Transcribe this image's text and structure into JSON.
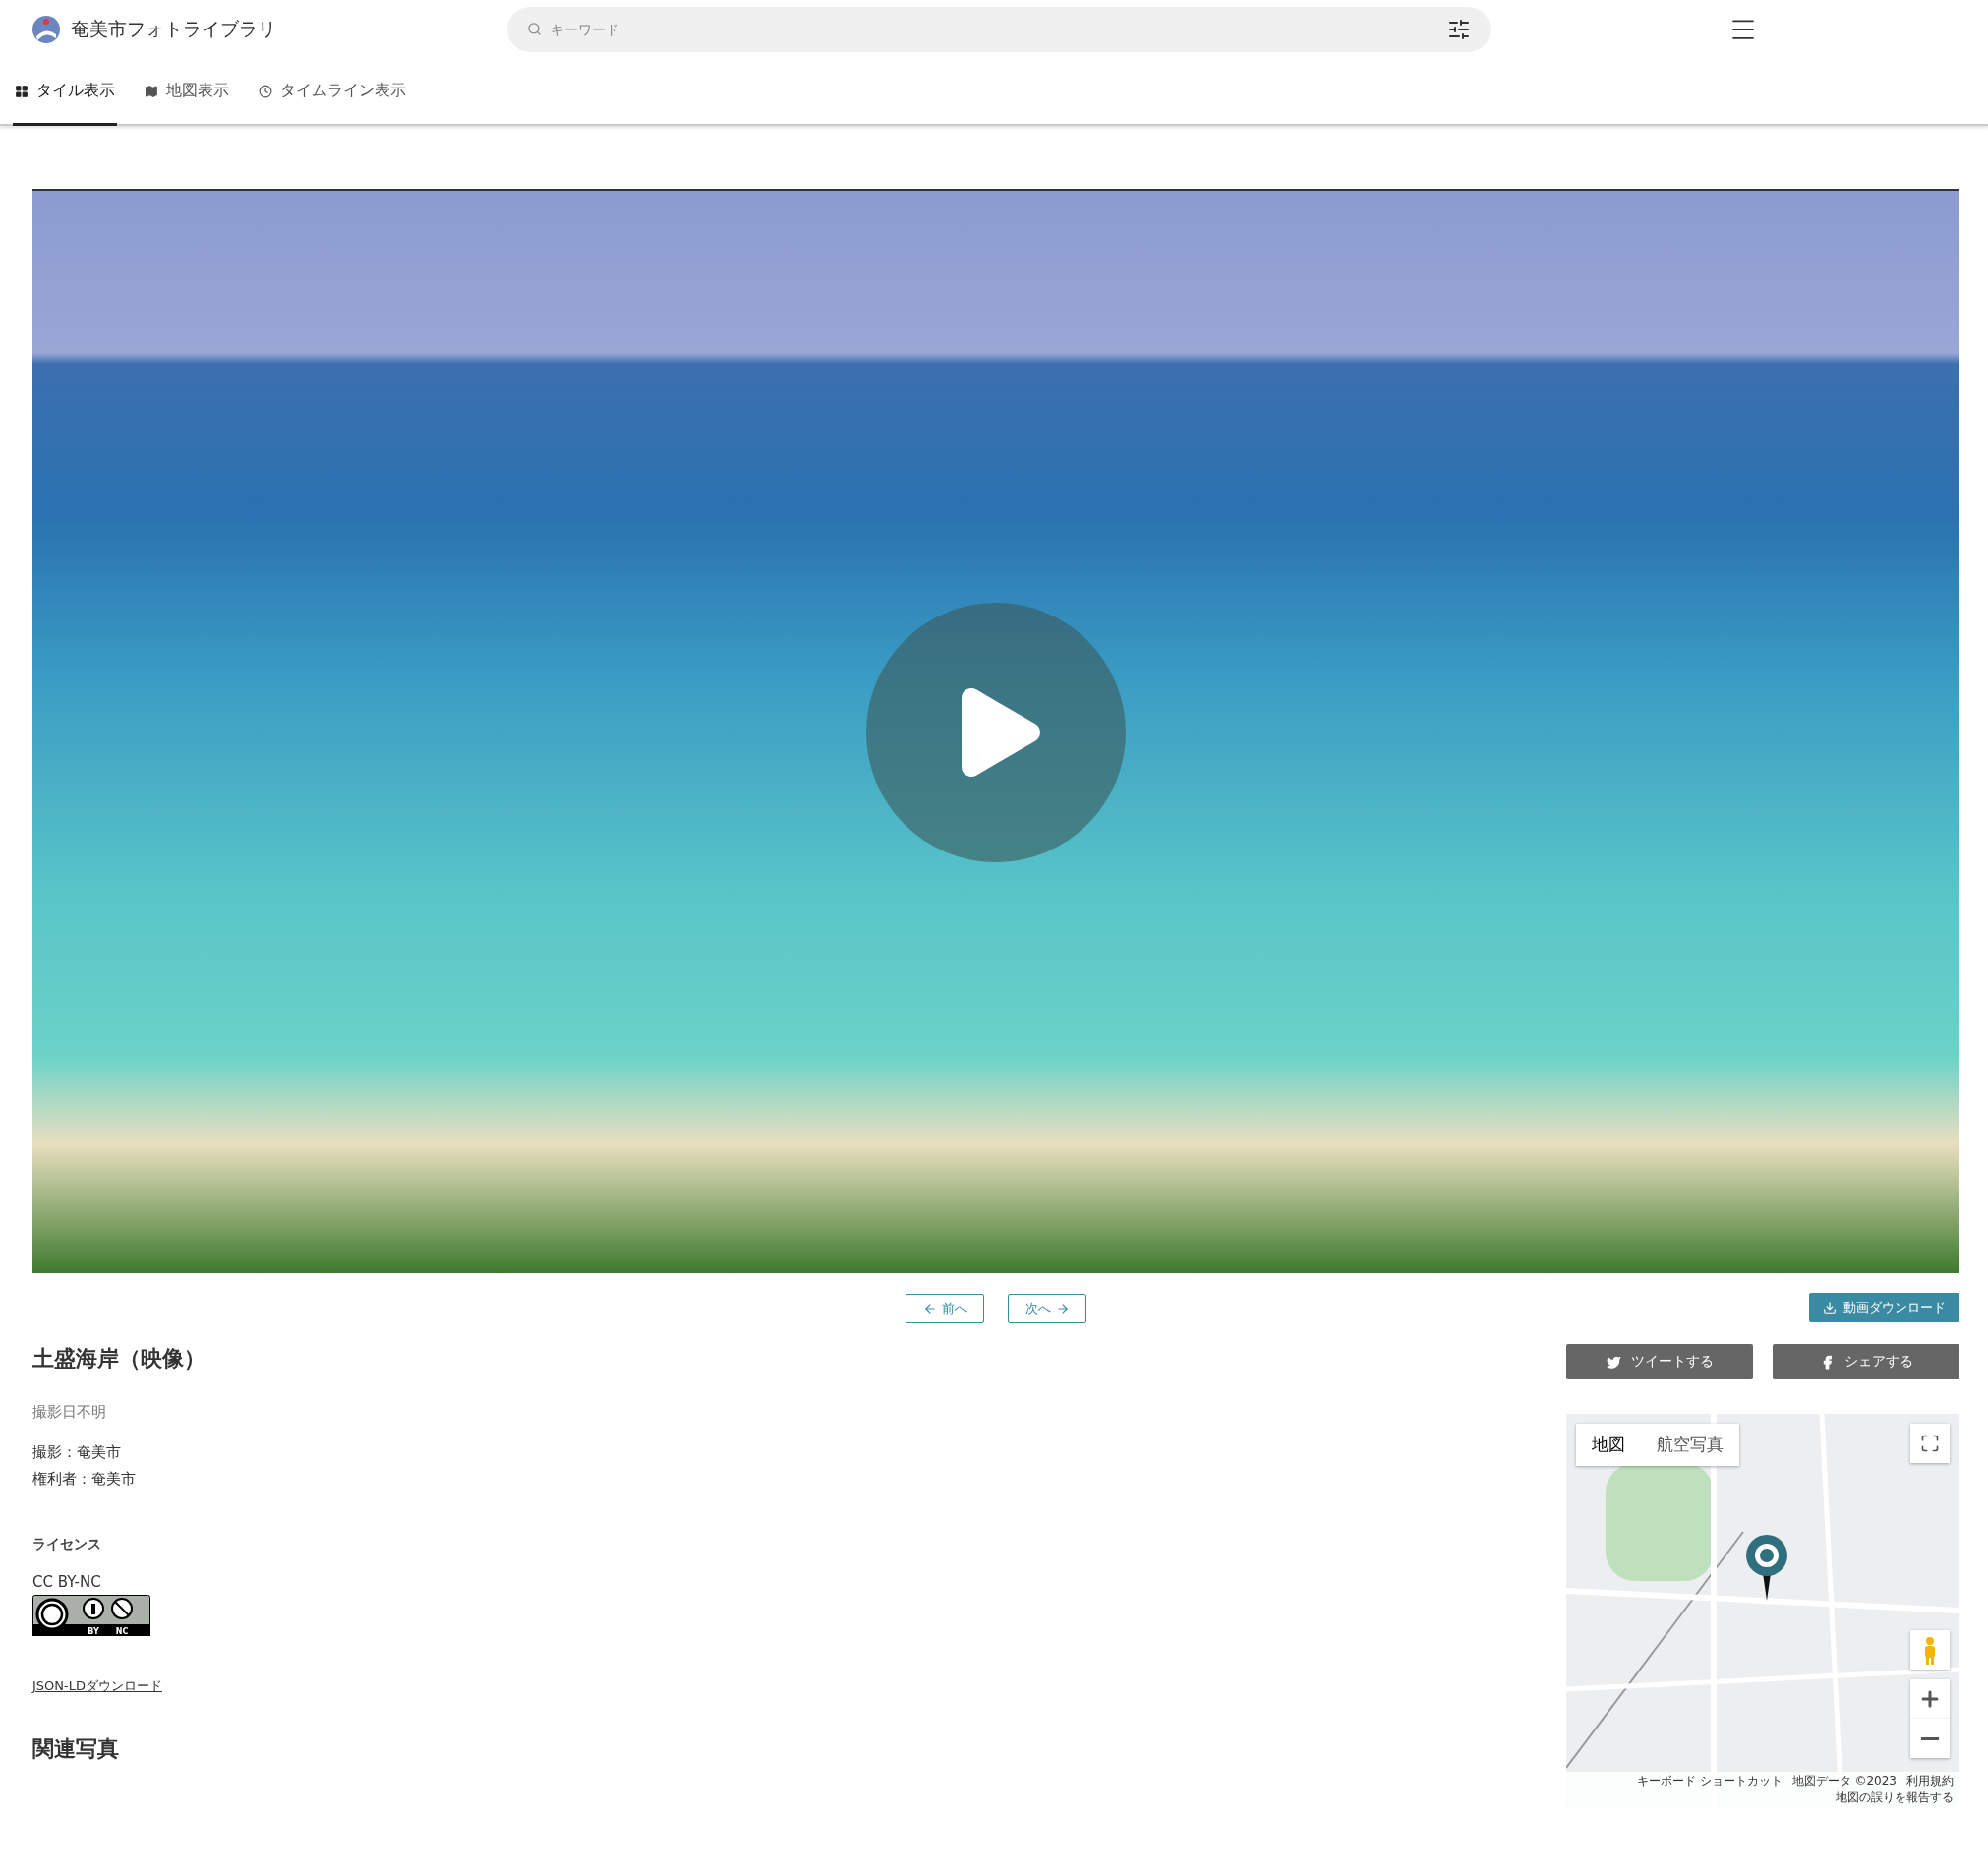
{
  "header": {
    "site_title": "奄美市フォトライブラリ",
    "search": {
      "placeholder": "キーワード"
    }
  },
  "tabs": [
    {
      "label": "タイル表示",
      "selected": true
    },
    {
      "label": "地図表示",
      "selected": false
    },
    {
      "label": "タイムライン表示",
      "selected": false
    }
  ],
  "pager": {
    "prev": "前へ",
    "next": "次へ"
  },
  "download_button": "動画ダウンロード",
  "share_buttons": [
    {
      "label": "ツイートする"
    },
    {
      "label": "シェアする"
    }
  ],
  "details": {
    "title": "土盛海岸（映像）",
    "date": "撮影日不明",
    "credits": [
      "撮影：奄美市",
      "権利者：奄美市"
    ],
    "license_heading": "ライセンス",
    "license": "CC BY-NC",
    "badge_labels": [
      "BY",
      "NC"
    ],
    "jsonld_link": "JSON-LDダウンロード"
  },
  "map": {
    "types": [
      {
        "label": "地図",
        "selected": true
      },
      {
        "label": "航空写真",
        "selected": false
      }
    ],
    "footer": [
      "キーボード ショートカット",
      "地図データ ©2023",
      "利用規約",
      "地図の誤りを報告する"
    ]
  },
  "related_heading": "関連写真"
}
